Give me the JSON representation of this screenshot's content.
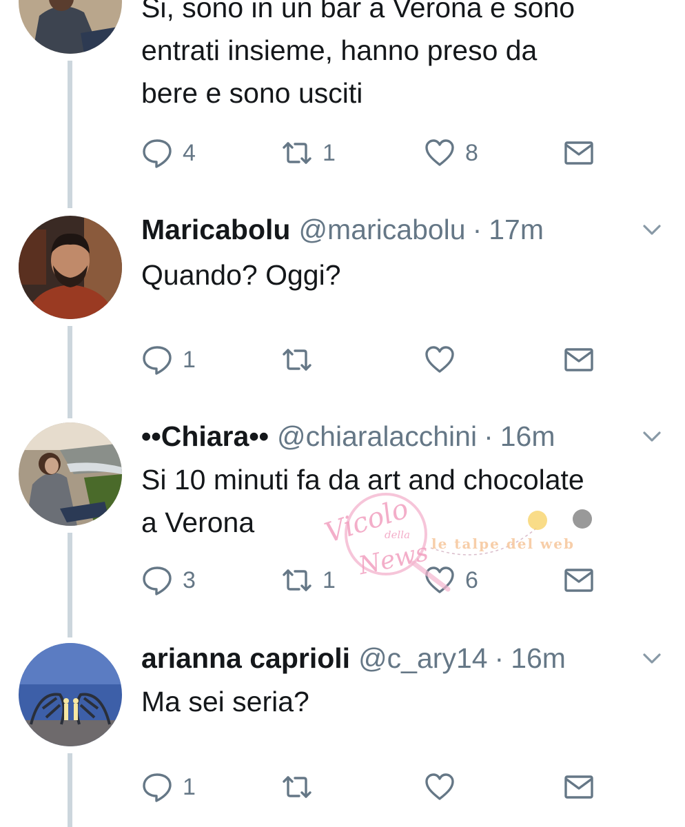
{
  "tweets": [
    {
      "name": "",
      "handle": "",
      "time": "",
      "text_lines": [
        "Si, sono in un bar a Verona e sono",
        "entrati insieme, hanno preso da",
        "bere e sono usciti"
      ],
      "replies": "4",
      "retweets": "1",
      "likes": "8"
    },
    {
      "name": "Maricabolu",
      "handle": "@maricabolu",
      "dot": "·",
      "time": "17m",
      "text_lines": [
        "Quando? Oggi?"
      ],
      "replies": "1",
      "retweets": "",
      "likes": ""
    },
    {
      "name": "••Chiara••",
      "handle": "@chiaralacchini",
      "dot": "·",
      "time": "16m",
      "text_lines": [
        "Si 10 minuti fa da art and chocolate",
        "a Verona"
      ],
      "replies": "3",
      "retweets": "1",
      "likes": "6"
    },
    {
      "name": "arianna caprioli",
      "handle": "@c_ary14",
      "dot": "·",
      "time": "16m",
      "text_lines": [
        "Ma sei seria?"
      ],
      "replies": "1",
      "retweets": "",
      "likes": ""
    }
  ],
  "watermark": {
    "brand_word_1": "Vicolo",
    "brand_word_2": "della",
    "brand_word_3": "News",
    "tagline": "le talpe del web"
  },
  "colors": {
    "text": "#14171a",
    "secondary": "#657786",
    "thread_line": "#ccd6dd",
    "watermark_pink": "#f2a0c0"
  },
  "icons": {
    "reply": "speech-bubble-icon",
    "retweet": "retweet-arrows-icon",
    "like": "heart-icon",
    "dm": "envelope-icon",
    "more": "chevron-down-icon"
  }
}
